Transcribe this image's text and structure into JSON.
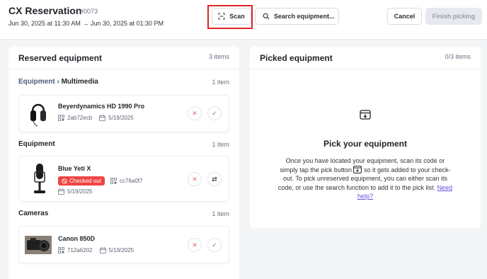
{
  "header": {
    "title": "CX Reservation",
    "reservation_number": "#0073",
    "dates": "Jun 30, 2025 at 11:30 AM → Jun 30, 2025 at 01:30 PM",
    "scan_label": "Scan",
    "search_label": "Search equipment...",
    "cancel_label": "Cancel",
    "finish_label": "Finish picking"
  },
  "reserved": {
    "title": "Reserved equipment",
    "count": "3 items",
    "sections": [
      {
        "crumb": "Equipment ›",
        "name": "Multimedia",
        "count": "1 item",
        "item": {
          "name": "Beyerdynamics HD 1990 Pro",
          "code": "2ab72ecb",
          "date": "5/19/2025"
        }
      },
      {
        "name": "Equipment",
        "count": "1 item",
        "item": {
          "name": "Blue Yeti X",
          "status": "Checked out",
          "code": "cc76a0f7",
          "date": "5/19/2025"
        }
      },
      {
        "name": "Cameras",
        "count": "1 item",
        "item": {
          "name": "Canon 850D",
          "code": "712a6202",
          "date": "5/19/2025"
        }
      }
    ]
  },
  "picked": {
    "title": "Picked equipment",
    "count": "0/3 items",
    "empty_title": "Pick your equipment",
    "empty_text_1": "Once you have located your equipment, scan its code or simply tap the pick button",
    "empty_text_2": "so it gets added to your check-out. To pick unreserved equipment, you can either scan its code, or use the search function to add it to the pick list.",
    "help_link": "Need help?"
  },
  "colors": {
    "danger": "#ef4444",
    "highlight": "#e02424",
    "link": "#6d4cdb"
  }
}
